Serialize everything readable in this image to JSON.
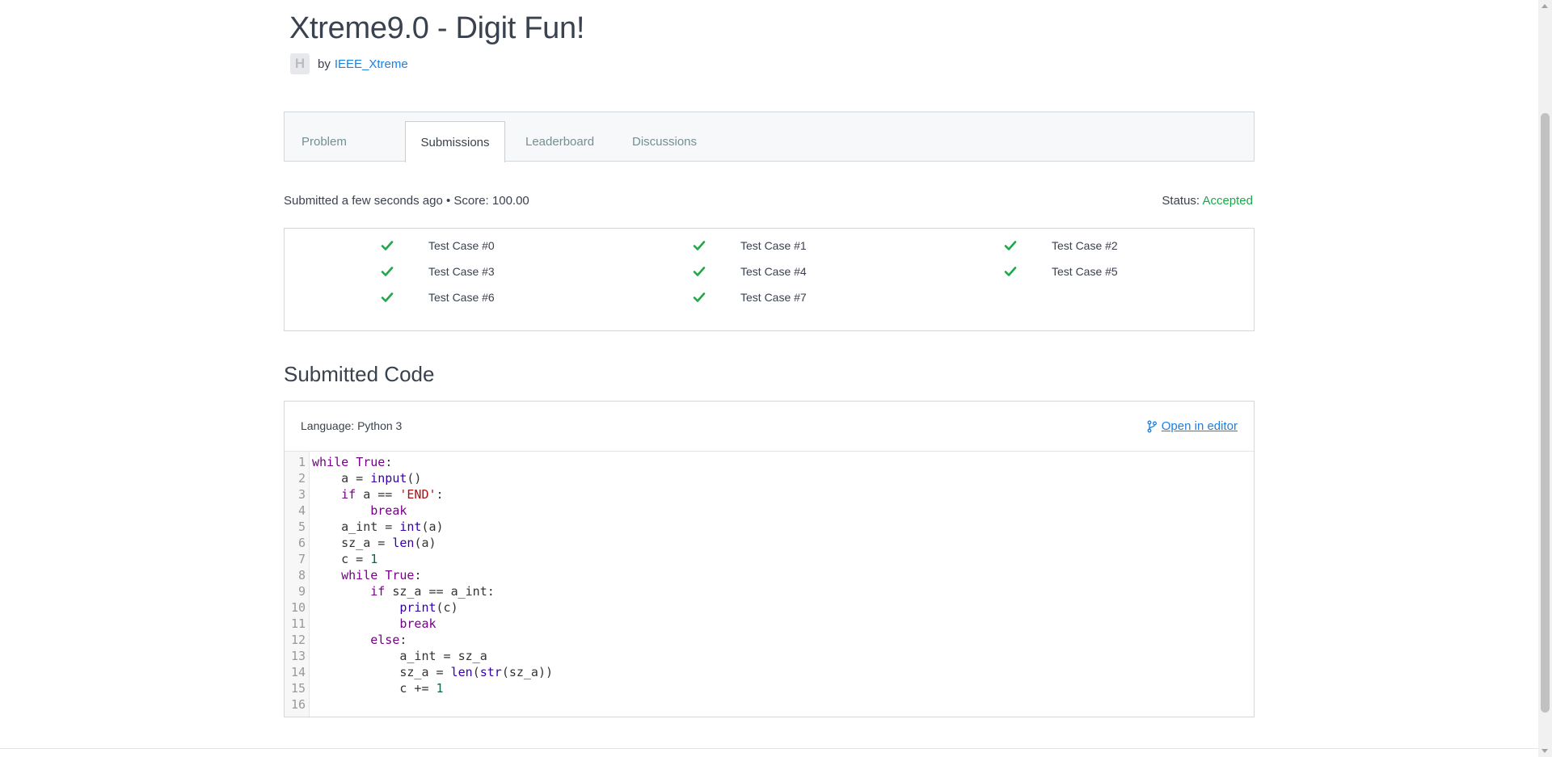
{
  "challenge": {
    "title": "Xtreme9.0 - Digit Fun!",
    "by_label": "by",
    "author": "IEEE_Xtreme",
    "avatar_letter": "H"
  },
  "tabs": [
    {
      "label": "Problem",
      "active": false
    },
    {
      "label": "Submissions",
      "active": true
    },
    {
      "label": "Leaderboard",
      "active": false
    },
    {
      "label": "Discussions",
      "active": false
    }
  ],
  "submission": {
    "meta": "Submitted a few seconds ago • Score: 100.00",
    "status_label": "Status:",
    "status_value": "Accepted",
    "status_color": "#1ba94c"
  },
  "test_cases": [
    {
      "label": "Test Case #0",
      "passed": true,
      "icon": "check-icon"
    },
    {
      "label": "Test Case #1",
      "passed": true,
      "icon": "check-icon"
    },
    {
      "label": "Test Case #2",
      "passed": true,
      "icon": "check-icon"
    },
    {
      "label": "Test Case #3",
      "passed": true,
      "icon": "check-icon"
    },
    {
      "label": "Test Case #4",
      "passed": true,
      "icon": "check-icon"
    },
    {
      "label": "Test Case #5",
      "passed": true,
      "icon": "check-icon"
    },
    {
      "label": "Test Case #6",
      "passed": true,
      "icon": "check-icon"
    },
    {
      "label": "Test Case #7",
      "passed": true,
      "icon": "check-icon"
    }
  ],
  "code_section": {
    "heading": "Submitted Code",
    "language": "Language: Python 3",
    "open_in_editor": "Open in editor",
    "open_icon": "branch-icon",
    "lines": [
      "while True:",
      "    a = input()",
      "    if a == 'END':",
      "        break",
      "    a_int = int(a)",
      "    sz_a = len(a)",
      "    c = 1",
      "    while True:",
      "        if sz_a == a_int:",
      "            print(c)",
      "            break",
      "        else:",
      "            a_int = sz_a",
      "            sz_a = len(str(sz_a))",
      "            c += 1",
      ""
    ]
  },
  "colors": {
    "accent": "#1d7fe0",
    "success": "#1ba94c",
    "text": "#39424e"
  }
}
